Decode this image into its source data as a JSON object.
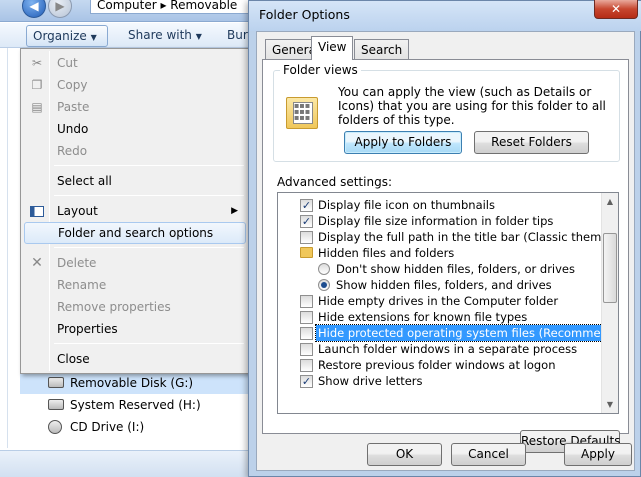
{
  "explorer": {
    "address": "Computer ▸ Removable",
    "commands": {
      "organize": "Organize",
      "share": "Share with",
      "burn": "Burn"
    },
    "drives": [
      "Removable Disk (G:)",
      "System Reserved (H:)",
      "CD Drive (I:)"
    ]
  },
  "organize_menu": {
    "items": [
      {
        "label": "Cut",
        "enabled": false,
        "icon": "scissors-icon"
      },
      {
        "label": "Copy",
        "enabled": false,
        "icon": "copy-icon"
      },
      {
        "label": "Paste",
        "enabled": false,
        "icon": "paste-icon"
      },
      {
        "label": "Undo",
        "enabled": true
      },
      {
        "label": "Redo",
        "enabled": false
      },
      {
        "label": "Select all",
        "enabled": true
      },
      {
        "label": "Layout",
        "enabled": true,
        "icon": "layout-icon",
        "submenu": true
      },
      {
        "label": "Folder and search options",
        "enabled": true,
        "highlighted": true
      },
      {
        "label": "Delete",
        "enabled": false,
        "icon": "delete-x-icon"
      },
      {
        "label": "Rename",
        "enabled": false
      },
      {
        "label": "Remove properties",
        "enabled": false
      },
      {
        "label": "Properties",
        "enabled": true
      },
      {
        "label": "Close",
        "enabled": true
      }
    ]
  },
  "dialog": {
    "title": "Folder Options",
    "close_glyph": "✕",
    "tabs": [
      "General",
      "View",
      "Search"
    ],
    "active_tab": "View",
    "folder_views": {
      "label": "Folder views",
      "text": "You can apply the view (such as Details or Icons) that you are using for this folder to all folders of this type.",
      "apply_button": "Apply to Folders",
      "reset_button": "Reset Folders"
    },
    "advanced_label": "Advanced settings:",
    "advanced_items": [
      {
        "label": "Display file icon on thumbnails",
        "kind": "checkbox",
        "checked": true,
        "level": 1
      },
      {
        "label": "Display file size information in folder tips",
        "kind": "checkbox",
        "checked": true,
        "level": 1
      },
      {
        "label": "Display the full path in the title bar (Classic theme only)",
        "kind": "checkbox",
        "checked": false,
        "level": 1
      },
      {
        "label": "Hidden files and folders",
        "kind": "folder",
        "level": 1
      },
      {
        "label": "Don't show hidden files, folders, or drives",
        "kind": "radio",
        "checked": false,
        "level": 2
      },
      {
        "label": "Show hidden files, folders, and drives",
        "kind": "radio",
        "checked": true,
        "level": 2
      },
      {
        "label": "Hide empty drives in the Computer folder",
        "kind": "checkbox",
        "checked": false,
        "level": 1
      },
      {
        "label": "Hide extensions for known file types",
        "kind": "checkbox",
        "checked": false,
        "level": 1
      },
      {
        "label": "Hide protected operating system files (Recommended)",
        "kind": "checkbox",
        "checked": false,
        "level": 1,
        "selected": true
      },
      {
        "label": "Launch folder windows in a separate process",
        "kind": "checkbox",
        "checked": false,
        "level": 1
      },
      {
        "label": "Restore previous folder windows at logon",
        "kind": "checkbox",
        "checked": false,
        "level": 1
      },
      {
        "label": "Show drive letters",
        "kind": "checkbox",
        "checked": true,
        "level": 1
      }
    ],
    "restore_defaults": "Restore Defaults",
    "ok": "OK",
    "cancel": "Cancel",
    "apply": "Apply"
  }
}
